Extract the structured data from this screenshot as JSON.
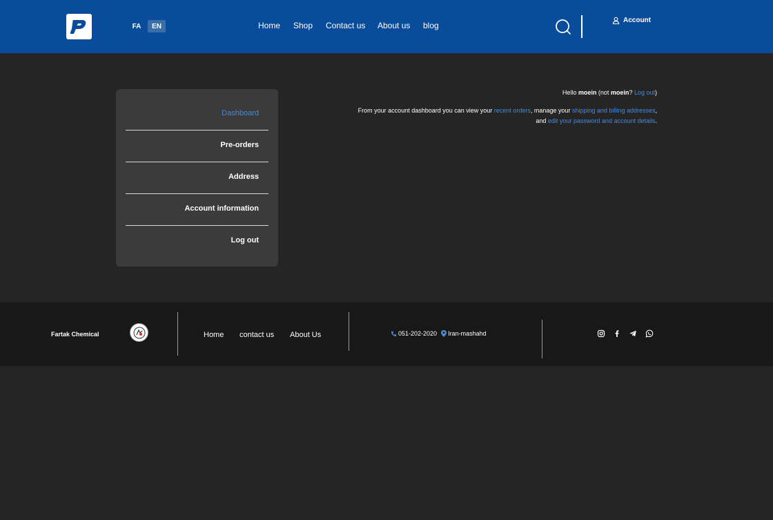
{
  "header": {
    "languages": [
      "FA",
      "EN"
    ],
    "active_language": "EN",
    "nav": [
      "Home",
      "Shop",
      "Contact us",
      "About us",
      "blog"
    ],
    "account_label": "Account"
  },
  "sidebar": {
    "items": [
      {
        "label": "Dashboard",
        "active": true
      },
      {
        "label": "Pre-orders",
        "active": false
      },
      {
        "label": "Address",
        "active": false
      },
      {
        "label": "Account information",
        "active": false
      },
      {
        "label": "Log out",
        "active": false
      }
    ]
  },
  "content": {
    "hello_prefix": "Hello",
    "username": "moein",
    "not_text": "(not",
    "not_suffix": "?",
    "logout_link": "Log out",
    "close_paren": ")",
    "desc_1": "From your account dashboard you can view your",
    "recent_orders": "recent orders",
    "desc_2": ", manage your",
    "shipping": "shipping and billing addresses",
    "desc_3": ", and",
    "edit_details": "edit your password and account details",
    "desc_4": "."
  },
  "footer": {
    "brand": "Fartak Chemical",
    "links": [
      "Home",
      "contact us",
      "About Us"
    ],
    "phone": "051-202-2020",
    "location": "Iran-mashahd",
    "social": [
      "instagram-icon",
      "facebook-icon",
      "telegram-icon",
      "whatsapp-icon"
    ]
  },
  "colors": {
    "header_bg": "#0a4c9c",
    "page_bg": "#252525",
    "sidebar_bg": "#3b3b3b",
    "footer_bg": "#181818",
    "link": "#4a8bd6"
  }
}
